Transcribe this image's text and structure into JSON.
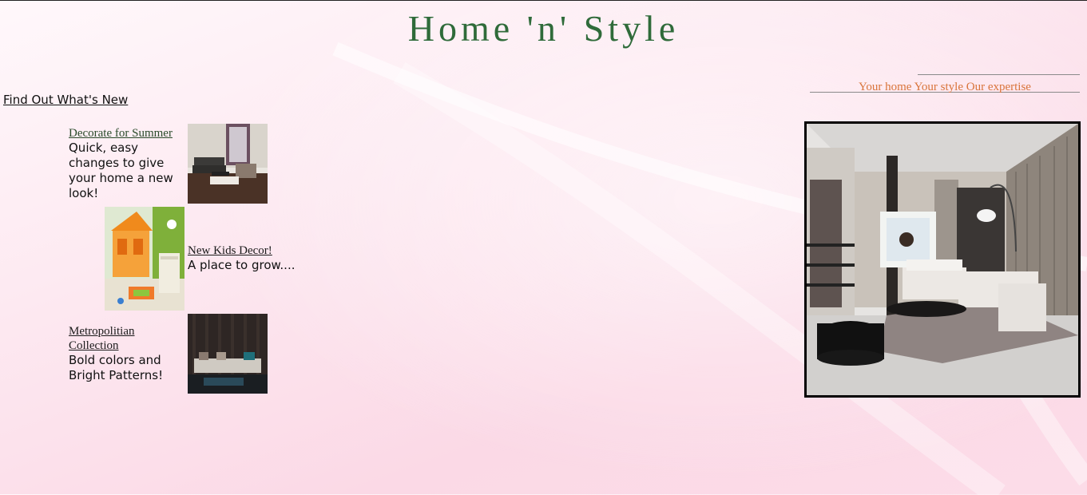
{
  "header": {
    "title": "Home 'n' Style"
  },
  "tagline": "Your home Your style Our expertise",
  "whats_new": {
    "heading": "Find Out What's New",
    "items": [
      {
        "link": "Decorate for Summer",
        "description": "Quick, easy changes to give your home a new look!"
      },
      {
        "link": "New Kids Decor!",
        "description": "A place to grow...."
      },
      {
        "link": "Metropolitian Collection",
        "description": "Bold colors and Bright Patterns!"
      }
    ]
  },
  "colors": {
    "title": "#2f6b3a",
    "tagline": "#d9743a"
  }
}
